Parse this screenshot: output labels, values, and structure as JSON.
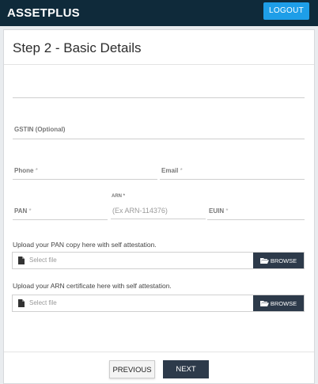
{
  "header": {
    "logo": "ASSETPLUS",
    "logout_label": "LOGOUT"
  },
  "form": {
    "title": "Step 2 - Basic Details",
    "gstin_label": "GSTIN (Optional)",
    "phone_label": "Phone",
    "email_label": "Email",
    "pan_label": "PAN",
    "arn_label": "ARN",
    "arn_placeholder": "(Ex ARN-114376)",
    "euin_label": "EUIN",
    "required_mark": "*",
    "pan_upload_text": "Upload your PAN copy here with self attestation.",
    "arn_upload_text": "Upload your ARN certificate here with self attestation.",
    "file_placeholder": "Select file",
    "browse_label": "BROWSE"
  },
  "footer": {
    "previous_label": "PREVIOUS",
    "next_label": "NEXT"
  },
  "colors": {
    "topbar": "#0f2a3a",
    "logout": "#1e9ee8",
    "dark_button": "#2d3a4a"
  }
}
